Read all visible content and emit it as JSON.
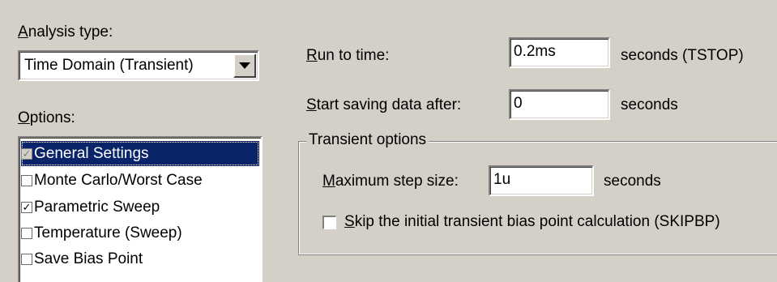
{
  "analysis_type": {
    "label_prefix": "A",
    "label_rest": "nalysis type:",
    "selected": "Time Domain (Transient)"
  },
  "options": {
    "label_prefix": "O",
    "label_rest": "ptions:",
    "items": [
      {
        "label": "General Settings",
        "checked": true,
        "selected": true
      },
      {
        "label": "Monte Carlo/Worst Case",
        "checked": false,
        "selected": false
      },
      {
        "label": "Parametric Sweep",
        "checked": true,
        "selected": false
      },
      {
        "label": "Temperature (Sweep)",
        "checked": false,
        "selected": false
      },
      {
        "label": "Save Bias Point",
        "checked": false,
        "selected": false
      }
    ]
  },
  "run_to_time": {
    "label_prefix": "R",
    "label_rest": "un to time:",
    "value": "0.2ms",
    "suffix": "seconds  (TSTOP)"
  },
  "start_saving": {
    "label_prefix": "S",
    "label_rest": "tart saving data after:",
    "value": "0",
    "suffix": "seconds"
  },
  "transient_options": {
    "title_prefix": "T",
    "title_rest": "ransient options",
    "max_step": {
      "label_prefix": "M",
      "label_rest": "aximum step size:",
      "value": "1u",
      "suffix": "seconds"
    },
    "skip_bias": {
      "label_prefix": "S",
      "label_rest": "kip the initial transient bias point calculation  (SKIPBP)",
      "checked": false
    }
  }
}
